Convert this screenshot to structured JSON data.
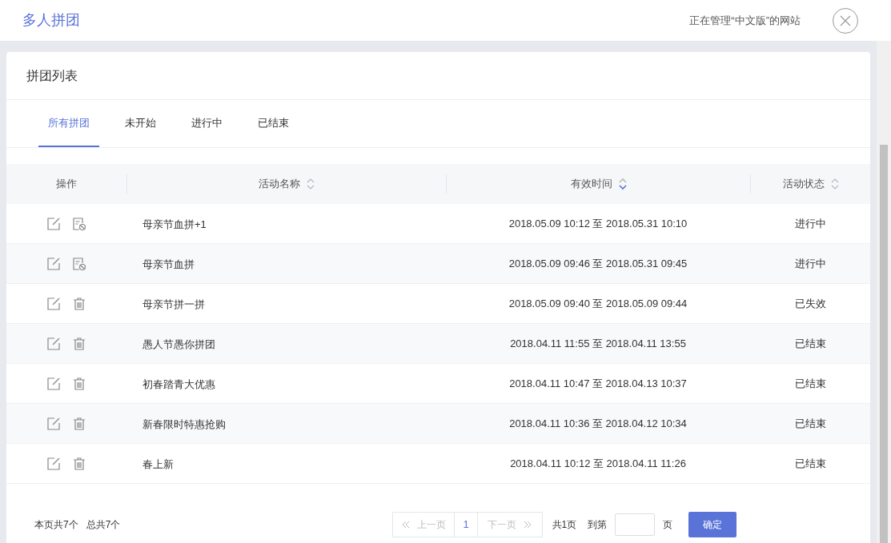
{
  "header": {
    "title": "多人拼团",
    "site_note": "正在管理“中文版”的网站"
  },
  "panel": {
    "title": "拼团列表"
  },
  "tabs": [
    {
      "label": "所有拼团",
      "selected": true
    },
    {
      "label": "未开始",
      "selected": false
    },
    {
      "label": "进行中",
      "selected": false
    },
    {
      "label": "已结束",
      "selected": false
    }
  ],
  "table": {
    "columns": [
      {
        "label": "操作",
        "sortable": false,
        "sorted_desc": false
      },
      {
        "label": "活动名称",
        "sortable": true,
        "sorted_desc": false
      },
      {
        "label": "有效时间",
        "sortable": true,
        "sorted_desc": true
      },
      {
        "label": "活动状态",
        "sortable": true,
        "sorted_desc": false
      }
    ],
    "rows": [
      {
        "can_disable": true,
        "name": "母亲节血拼+1",
        "time": "2018.05.09 10:12 至 2018.05.31 10:10",
        "status": "进行中"
      },
      {
        "can_disable": true,
        "name": "母亲节血拼",
        "time": "2018.05.09 09:46 至 2018.05.31 09:45",
        "status": "进行中"
      },
      {
        "can_disable": false,
        "name": "母亲节拼一拼",
        "time": "2018.05.09 09:40 至 2018.05.09 09:44",
        "status": "已失效"
      },
      {
        "can_disable": false,
        "name": "愚人节愚你拼团",
        "time": "2018.04.11 11:55 至 2018.04.11 13:55",
        "status": "已结束"
      },
      {
        "can_disable": false,
        "name": "初春踏青大优惠",
        "time": "2018.04.11 10:47 至 2018.04.13 10:37",
        "status": "已结束"
      },
      {
        "can_disable": false,
        "name": "新春限时特惠抢购",
        "time": "2018.04.11 10:36 至 2018.04.12 10:34",
        "status": "已结束"
      },
      {
        "can_disable": false,
        "name": "春上新",
        "time": "2018.04.11 10:12 至 2018.04.11 11:26",
        "status": "已结束"
      }
    ]
  },
  "footer": {
    "page_count": "本页共7个",
    "total": "总共7个"
  },
  "pagination": {
    "prev": {
      "label": "上一页",
      "disabled": true
    },
    "pages": [
      {
        "label": "1",
        "selected": true
      }
    ],
    "next": {
      "label": "下一页",
      "disabled": true
    },
    "total_pages": "共1页",
    "goto_label": "到第",
    "page_suffix": "页",
    "confirm": "确定"
  }
}
